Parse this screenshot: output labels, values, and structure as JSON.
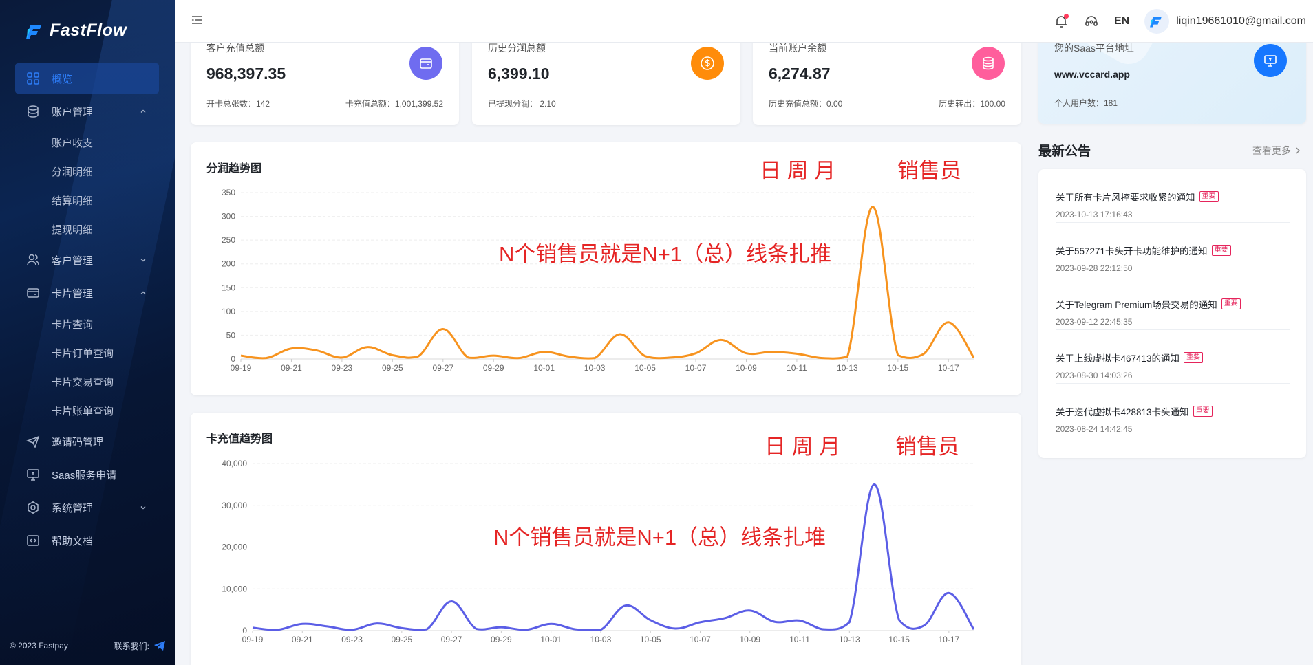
{
  "brand": {
    "name": "FastFlow"
  },
  "sidebar": {
    "items": [
      {
        "label": "概览",
        "icon": "dashboard-icon",
        "active": true
      },
      {
        "label": "账户管理",
        "icon": "database-icon",
        "expanded": true,
        "children": [
          "账户收支",
          "分润明细",
          "结算明细",
          "提现明细"
        ]
      },
      {
        "label": "客户管理",
        "icon": "users-icon",
        "expanded": false
      },
      {
        "label": "卡片管理",
        "icon": "card-icon",
        "expanded": true,
        "children": [
          "卡片查询",
          "卡片订单查询",
          "卡片交易查询",
          "卡片账单查询"
        ]
      },
      {
        "label": "邀请码管理",
        "icon": "send-icon"
      },
      {
        "label": "Saas服务申请",
        "icon": "monitor-icon"
      },
      {
        "label": "系统管理",
        "icon": "settings-icon",
        "expanded": false
      },
      {
        "label": "帮助文档",
        "icon": "code-icon"
      }
    ],
    "footer": {
      "copyright": "© 2023 Fastpay",
      "contact": "联系我们:"
    }
  },
  "topbar": {
    "lang": "EN",
    "email": "liqin19661010@gmail.com"
  },
  "stats": [
    {
      "label": "客户充值总额",
      "value": "968,397.35",
      "foot_left": "开卡总张数：142",
      "foot_right": "卡充值总额：1,001,399.52",
      "color": "#6f6cf0"
    },
    {
      "label": "历史分润总额",
      "value": "6,399.10",
      "foot_left": "已提现分润： 2.10",
      "foot_right": "",
      "color": "#ff8c0a"
    },
    {
      "label": "当前账户余额",
      "value": "6,274.87",
      "foot_left": "历史充值总额：0.00",
      "foot_right": "历史转出：100.00",
      "color": "#ff5e9c"
    }
  ],
  "saas": {
    "label": "您的Saas平台地址",
    "url": "www.vccard.app",
    "foot": "个人用户数：181",
    "color": "#1677ff"
  },
  "charts": {
    "profit": {
      "title": "分润趋势图",
      "anno_period": "日 周 月",
      "anno_sales": "销售员",
      "anno_note": "N个销售员就是N+1（总）线条扎推"
    },
    "recharge": {
      "title": "卡充值趋势图",
      "anno_period": "日 周 月",
      "anno_sales": "销售员",
      "anno_note": "N个销售员就是N+1（总）线条扎堆"
    }
  },
  "chart_data": [
    {
      "type": "line",
      "title": "分润趋势图",
      "x": [
        "09-19",
        "09-20",
        "09-21",
        "09-22",
        "09-23",
        "09-24",
        "09-25",
        "09-26",
        "09-27",
        "09-28",
        "09-29",
        "09-30",
        "10-01",
        "10-02",
        "10-03",
        "10-04",
        "10-05",
        "10-06",
        "10-07",
        "10-08",
        "10-09",
        "10-10",
        "10-11",
        "10-12",
        "10-13",
        "10-14",
        "10-15",
        "10-16",
        "10-17",
        "10-18"
      ],
      "series": [
        {
          "values": [
            7,
            2,
            22,
            18,
            3,
            25,
            8,
            5,
            63,
            3,
            7,
            2,
            15,
            5,
            2,
            52,
            6,
            3,
            12,
            40,
            12,
            15,
            11,
            2,
            5,
            320,
            8,
            10,
            77,
            3
          ],
          "color": "#f7931e"
        }
      ],
      "xticks": [
        "09-19",
        "09-21",
        "09-23",
        "09-25",
        "09-27",
        "09-29",
        "10-01",
        "10-03",
        "10-05",
        "10-07",
        "10-09",
        "10-11",
        "10-13",
        "10-15",
        "10-17"
      ],
      "yticks": [
        0,
        50,
        100,
        150,
        200,
        250,
        300,
        350
      ],
      "ylim": [
        0,
        350
      ]
    },
    {
      "type": "line",
      "title": "卡充值趋势图",
      "x": [
        "09-19",
        "09-20",
        "09-21",
        "09-22",
        "09-23",
        "09-24",
        "09-25",
        "09-26",
        "09-27",
        "09-28",
        "09-29",
        "09-30",
        "10-01",
        "10-02",
        "10-03",
        "10-04",
        "10-05",
        "10-06",
        "10-07",
        "10-08",
        "10-09",
        "10-10",
        "10-11",
        "10-12",
        "10-13",
        "10-14",
        "10-15",
        "10-16",
        "10-17",
        "10-18"
      ],
      "series": [
        {
          "values": [
            700,
            200,
            1600,
            1000,
            200,
            1700,
            600,
            300,
            7000,
            400,
            800,
            200,
            1600,
            300,
            200,
            6000,
            2500,
            500,
            2000,
            3000,
            4800,
            2100,
            2400,
            300,
            2000,
            35000,
            2500,
            1200,
            9000,
            300
          ],
          "color": "#5b5ee6"
        }
      ],
      "xticks": [
        "09-19",
        "09-21",
        "09-23",
        "09-25",
        "09-27",
        "09-29",
        "10-01",
        "10-03",
        "10-05",
        "10-07",
        "10-09",
        "10-11",
        "10-13",
        "10-15",
        "10-17"
      ],
      "yticks": [
        0,
        10000,
        20000,
        30000,
        40000
      ],
      "ytick_labels": [
        "0",
        "10,000",
        "20,000",
        "30,000",
        "40,000"
      ],
      "ylim": [
        0,
        40000
      ]
    }
  ],
  "notices": {
    "title": "最新公告",
    "more": "查看更多",
    "tag": "重要",
    "items": [
      {
        "title": "关于所有卡片风控要求收紧的通知",
        "time": "2023-10-13 17:16:43"
      },
      {
        "title": "关于557271卡头开卡功能维护的通知",
        "time": "2023-09-28 22:12:50"
      },
      {
        "title": "关于Telegram Premium场景交易的通知",
        "time": "2023-09-12 22:45:35"
      },
      {
        "title": "关于上线虚拟卡467413的通知",
        "time": "2023-08-30 14:03:26"
      },
      {
        "title": "关于迭代虚拟卡428813卡头通知",
        "time": "2023-08-24 14:42:45"
      }
    ]
  }
}
